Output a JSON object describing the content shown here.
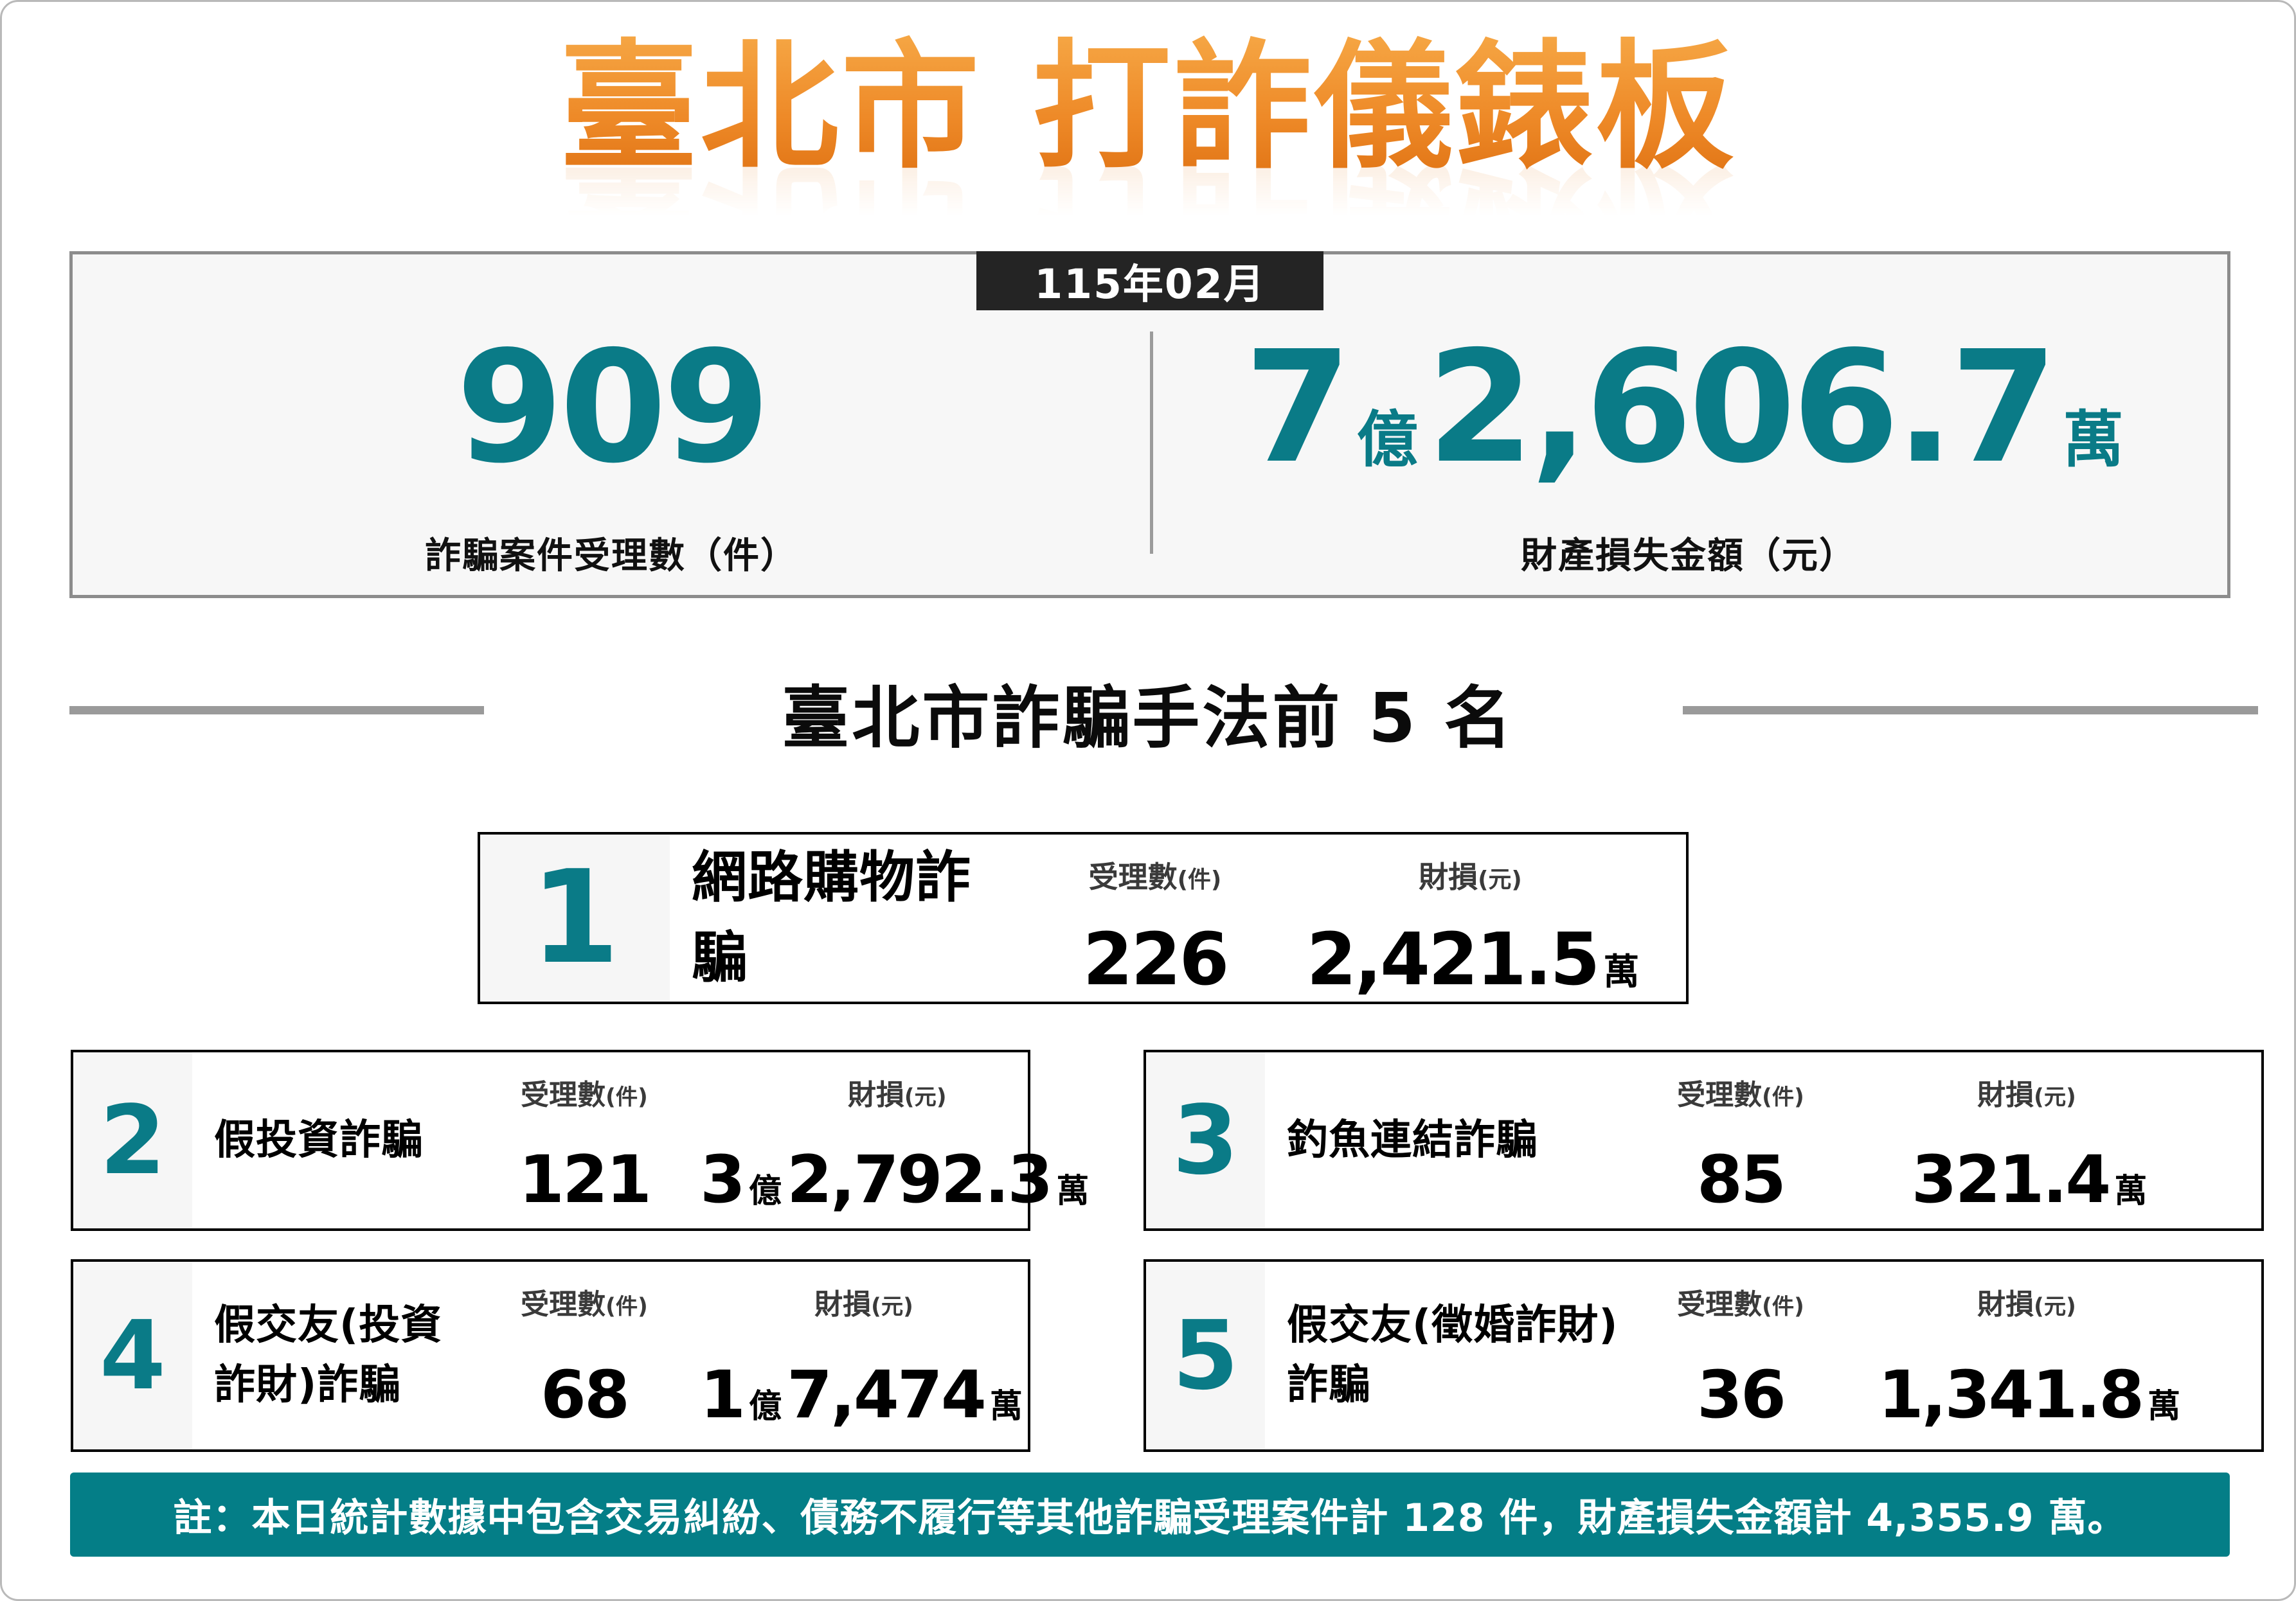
{
  "page": {
    "title": "臺北市 打詐儀錶板",
    "period_badge": "115年02月"
  },
  "summary": {
    "cases": {
      "value": "909",
      "label": "詐騙案件受理數（件）"
    },
    "loss": {
      "big1": "7",
      "unit1": "億",
      "big2": "2,606.7",
      "unit2": "萬",
      "label": "財產損失金額（元）"
    }
  },
  "ranking": {
    "section_title": "臺北市詐騙手法前 5 名",
    "headers": {
      "cases_main": "受理數",
      "cases_sub": "(件)",
      "loss_main": "財損",
      "loss_sub": "(元)"
    },
    "items": [
      {
        "rank": "1",
        "name": "網路購物詐騙",
        "cases": "226",
        "loss_big1": "",
        "loss_unit1": "",
        "loss_big2": "2,421.5",
        "loss_unit2": "萬"
      },
      {
        "rank": "2",
        "name": "假投資詐騙",
        "cases": "121",
        "loss_big1": "3",
        "loss_unit1": "億",
        "loss_big2": "2,792.3",
        "loss_unit2": "萬"
      },
      {
        "rank": "3",
        "name": "釣魚連結詐騙",
        "cases": "85",
        "loss_big1": "",
        "loss_unit1": "",
        "loss_big2": "321.4",
        "loss_unit2": "萬"
      },
      {
        "rank": "4",
        "name": "假交友(投資詐財)詐騙",
        "cases": "68",
        "loss_big1": "1",
        "loss_unit1": "億",
        "loss_big2": "7,474",
        "loss_unit2": "萬"
      },
      {
        "rank": "5",
        "name": "假交友(徵婚詐財)詐騙",
        "cases": "36",
        "loss_big1": "",
        "loss_unit1": "",
        "loss_big2": "1,341.8",
        "loss_unit2": "萬"
      }
    ]
  },
  "footer": {
    "note": "註：本日統計數據中包含交易糾紛、債務不履行等其他詐騙受理案件計 128 件，財產損失金額計 4,355.9 萬。"
  },
  "colors": {
    "accent_teal": "#047E87",
    "number_teal": "#0A7B87",
    "title_gradient_top": "#F7AC4A",
    "title_gradient_bottom": "#DD6E10",
    "badge_bg": "#242424"
  }
}
